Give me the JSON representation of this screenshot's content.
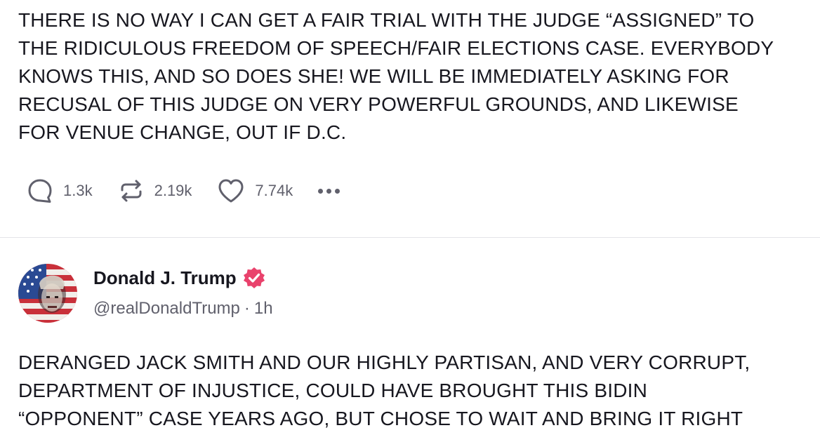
{
  "posts": [
    {
      "text": "THERE IS NO WAY I CAN GET A FAIR TRIAL WITH THE JUDGE “ASSIGNED” TO\nTHE RIDICULOUS FREEDOM OF SPEECH/FAIR ELECTIONS CASE. EVERYBODY\nKNOWS THIS, AND SO DOES SHE! WE WILL BE IMMEDIATELY ASKING FOR\nRECUSAL OF THIS JUDGE ON VERY POWERFUL GROUNDS, AND LIKEWISE\nFOR VENUE CHANGE, OUT IF D.C.",
      "actions": {
        "reply": {
          "icon": "reply-icon",
          "count": "1.3k"
        },
        "retruth": {
          "icon": "retruth-icon",
          "count": "2.19k"
        },
        "like": {
          "icon": "heart-icon",
          "count": "7.74k"
        },
        "more": {
          "icon": "more-icon"
        }
      }
    },
    {
      "author": {
        "name": "Donald J. Trump",
        "handle": "@realDonaldTrump",
        "separator": "·",
        "time": "1h",
        "verified": true,
        "avatar": "profile-avatar"
      },
      "text": "DERANGED JACK SMITH AND OUR HIGHLY PARTISAN, AND VERY CORRUPT,\nDEPARTMENT OF INJUSTICE, COULD HAVE BROUGHT THIS BIDIN\n“OPPONENT” CASE YEARS AGO, BUT CHOSE TO WAIT AND BRING IT RIGHT"
    }
  ],
  "colors": {
    "text": "#17171f",
    "muted": "#60606c",
    "divider": "#e4e4e8",
    "verified_badge": "#e9426c"
  }
}
